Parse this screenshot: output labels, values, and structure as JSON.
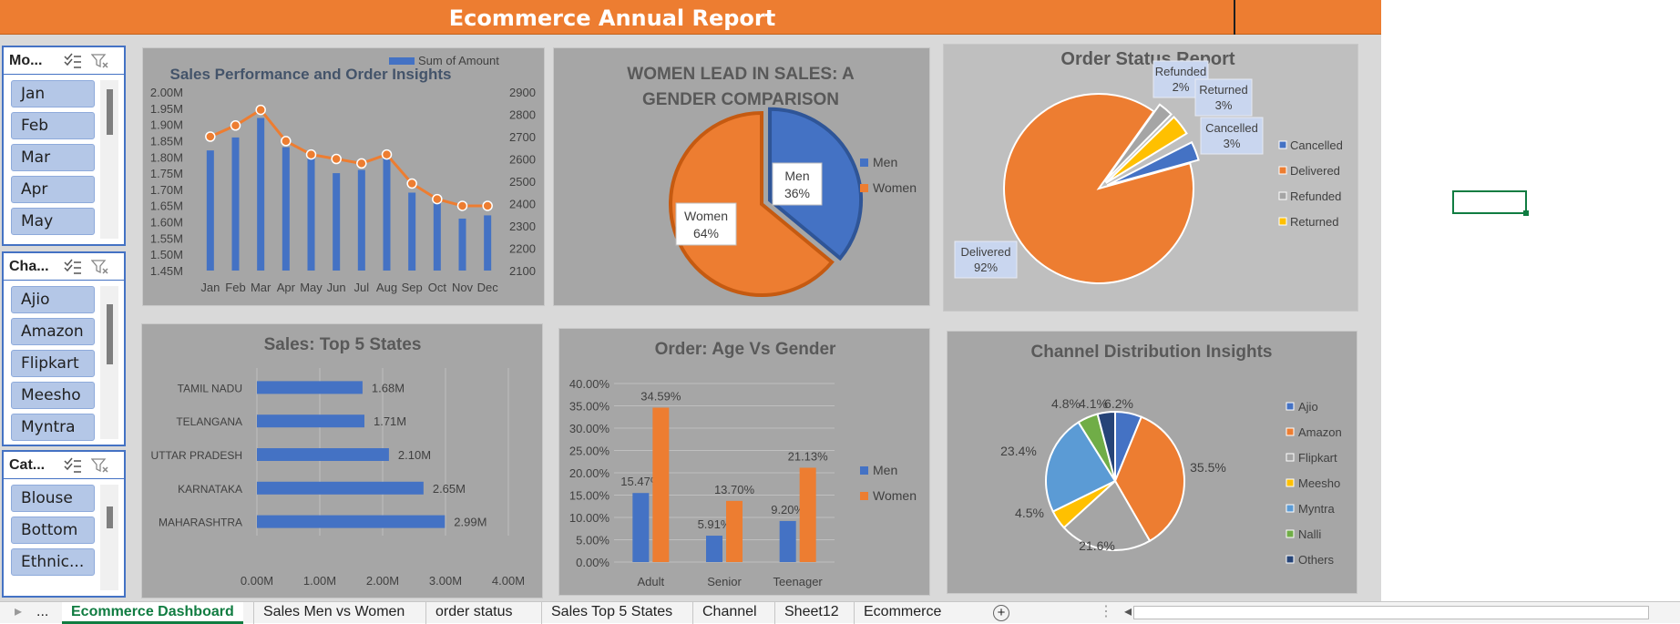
{
  "title": "Ecommerce Annual Report",
  "slicers": [
    {
      "label": "Mo...",
      "items": [
        "Jan",
        "Feb",
        "Mar",
        "Apr",
        "May"
      ]
    },
    {
      "label": "Cha...",
      "items": [
        "Ajio",
        "Amazon",
        "Flipkart",
        "Meesho",
        "Myntra"
      ]
    },
    {
      "label": "Cat...",
      "items": [
        "Blouse",
        "Bottom",
        "Ethnic..."
      ]
    }
  ],
  "colors": {
    "orange": "#ed7d31",
    "blue": "#4472c4",
    "yellow": "#ffc000",
    "gray": "#a5a5a5",
    "light_blue": "#5b9bd5",
    "green": "#70ad47",
    "navy": "#264478",
    "panel": "#a6a6a6"
  },
  "chart_data": [
    {
      "type": "bar",
      "title": "Sales Performance and Order Insights",
      "categories": [
        "Jan",
        "Feb",
        "Mar",
        "Apr",
        "May",
        "Jun",
        "Jul",
        "Aug",
        "Sep",
        "Oct",
        "Nov",
        "Dec"
      ],
      "series": [
        {
          "name": "Sum of Amount",
          "type": "bar",
          "values": [
            1820000,
            1860000,
            1920000,
            1830000,
            1800000,
            1750000,
            1760000,
            1800000,
            1690000,
            1660000,
            1610000,
            1620000
          ]
        },
        {
          "type": "line",
          "axis": "secondary",
          "values": [
            2700,
            2750,
            2820,
            2680,
            2620,
            2600,
            2580,
            2620,
            2490,
            2420,
            2390,
            2390
          ]
        }
      ],
      "yticks": [
        "1.45M",
        "1.50M",
        "1.55M",
        "1.60M",
        "1.65M",
        "1.70M",
        "1.75M",
        "1.80M",
        "1.85M",
        "1.90M",
        "1.95M",
        "2.00M"
      ],
      "ylim": [
        1450000,
        2000000
      ],
      "y2ticks": [
        "2100",
        "2200",
        "2300",
        "2400",
        "2500",
        "2600",
        "2700",
        "2800",
        "2900"
      ],
      "y2lim": [
        2100,
        2900
      ],
      "legend": "top-right"
    },
    {
      "type": "pie",
      "title": "WOMEN LEAD IN SALES: A GENDER COMPARISON",
      "slices": [
        {
          "label": "Men",
          "pct_label": "36%",
          "value": 36
        },
        {
          "label": "Women",
          "pct_label": "64%",
          "value": 64
        }
      ],
      "legend": "right"
    },
    {
      "type": "pie",
      "title": "Order Status Report",
      "slices": [
        {
          "label": "Cancelled",
          "pct_label": "3%",
          "value": 3
        },
        {
          "label": "Delivered",
          "pct_label": "92%",
          "value": 92
        },
        {
          "label": "Refunded",
          "pct_label": "2%",
          "value": 2
        },
        {
          "label": "Returned",
          "pct_label": "3%",
          "value": 3
        }
      ],
      "legend": "right"
    },
    {
      "type": "bar",
      "orientation": "horizontal",
      "title": "Sales: Top 5 States",
      "categories": [
        "TAMIL NADU",
        "TELANGANA",
        "UTTAR PRADESH",
        "KARNATAKA",
        "MAHARASHTRA"
      ],
      "values": [
        1.68,
        1.71,
        2.1,
        2.65,
        2.99
      ],
      "value_labels": [
        "1.68M",
        "1.71M",
        "2.10M",
        "2.65M",
        "2.99M"
      ],
      "xticks": [
        "0.00M",
        "1.00M",
        "2.00M",
        "3.00M",
        "4.00M"
      ],
      "xlim": [
        0,
        4
      ]
    },
    {
      "type": "bar",
      "title": "Order: Age Vs Gender",
      "categories": [
        "Adult",
        "Senior",
        "Teenager"
      ],
      "series": [
        {
          "name": "Men",
          "values": [
            15.47,
            5.91,
            9.2
          ],
          "labels": [
            "15.47%",
            "5.91%",
            "9.20%"
          ]
        },
        {
          "name": "Women",
          "values": [
            34.59,
            13.7,
            21.13
          ],
          "labels": [
            "34.59%",
            "13.70%",
            "21.13%"
          ]
        }
      ],
      "yticks": [
        "0.00%",
        "5.00%",
        "10.00%",
        "15.00%",
        "20.00%",
        "25.00%",
        "30.00%",
        "35.00%",
        "40.00%"
      ],
      "ylim": [
        0,
        40
      ],
      "legend": "right"
    },
    {
      "type": "pie",
      "title": "Channel Distribution Insights",
      "slices": [
        {
          "label": "Ajio",
          "pct_label": "6.2%",
          "value": 6.2
        },
        {
          "label": "Amazon",
          "pct_label": "35.5%",
          "value": 35.5
        },
        {
          "label": "Flipkart",
          "pct_label": "21.6%",
          "value": 21.6
        },
        {
          "label": "Meesho",
          "pct_label": "4.5%",
          "value": 4.5
        },
        {
          "label": "Myntra",
          "pct_label": "23.4%",
          "value": 23.4
        },
        {
          "label": "Nalli",
          "pct_label": "4.8%",
          "value": 4.8
        },
        {
          "label": "Others",
          "pct_label": "4.1%",
          "value": 4.1
        }
      ],
      "legend": "right"
    }
  ],
  "tabs": {
    "more": "...",
    "items": [
      "Ecommerce Dashboard",
      "Sales Men vs Women",
      "order status",
      "Sales Top 5 States",
      "Channel",
      "Sheet12",
      "Ecommerce"
    ],
    "active": "Ecommerce Dashboard",
    "add": "+"
  }
}
